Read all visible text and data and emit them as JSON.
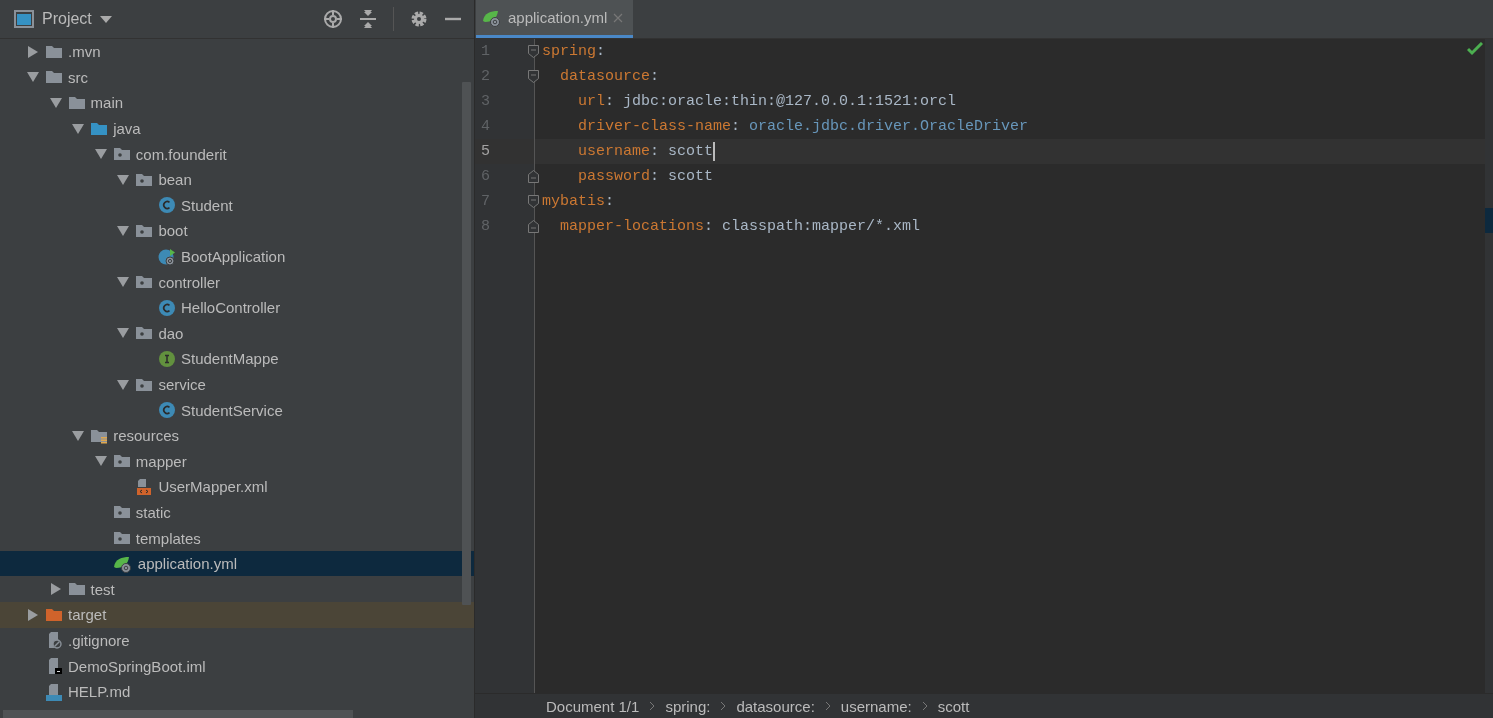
{
  "project_panel": {
    "title": "Project",
    "tree": [
      {
        "label": ".mvn",
        "kind": "folder",
        "expanded": false,
        "selected": false
      },
      {
        "label": "src",
        "kind": "folder",
        "expanded": true,
        "selected": false,
        "children": [
          {
            "label": "main",
            "kind": "folder",
            "expanded": true,
            "selected": false,
            "children": [
              {
                "label": "java",
                "kind": "source-folder",
                "expanded": true,
                "selected": false,
                "children": [
                  {
                    "label": "com.founderit",
                    "kind": "package",
                    "expanded": true,
                    "selected": false,
                    "children": [
                      {
                        "label": "bean",
                        "kind": "package",
                        "expanded": true,
                        "selected": false,
                        "children": [
                          {
                            "label": "Student",
                            "kind": "class",
                            "selected": false
                          }
                        ]
                      },
                      {
                        "label": "boot",
                        "kind": "package",
                        "expanded": true,
                        "selected": false,
                        "children": [
                          {
                            "label": "BootApplication",
                            "kind": "spring-class",
                            "selected": false
                          }
                        ]
                      },
                      {
                        "label": "controller",
                        "kind": "package",
                        "expanded": true,
                        "selected": false,
                        "children": [
                          {
                            "label": "HelloController",
                            "kind": "class",
                            "selected": false
                          }
                        ]
                      },
                      {
                        "label": "dao",
                        "kind": "package",
                        "expanded": true,
                        "selected": false,
                        "children": [
                          {
                            "label": "StudentMappe",
                            "kind": "interface",
                            "selected": false
                          }
                        ]
                      },
                      {
                        "label": "service",
                        "kind": "package",
                        "expanded": true,
                        "selected": false,
                        "children": [
                          {
                            "label": "StudentService",
                            "kind": "class",
                            "selected": false
                          }
                        ]
                      }
                    ]
                  }
                ]
              },
              {
                "label": "resources",
                "kind": "resources-folder",
                "expanded": true,
                "selected": false,
                "children": [
                  {
                    "label": "mapper",
                    "kind": "package",
                    "expanded": true,
                    "selected": false,
                    "children": [
                      {
                        "label": "UserMapper.xml",
                        "kind": "xml",
                        "selected": false
                      }
                    ]
                  },
                  {
                    "label": "static",
                    "kind": "package",
                    "selected": false
                  },
                  {
                    "label": "templates",
                    "kind": "package",
                    "selected": false
                  },
                  {
                    "label": "application.yml",
                    "kind": "spring-yml",
                    "selected": true
                  }
                ]
              }
            ]
          },
          {
            "label": "test",
            "kind": "folder",
            "expanded": false,
            "selected": false
          }
        ]
      },
      {
        "label": "target",
        "kind": "excluded-folder",
        "expanded": false,
        "selected": false
      },
      {
        "label": ".gitignore",
        "kind": "gitignore",
        "selected": false
      },
      {
        "label": "DemoSpringBoot.iml",
        "kind": "iml",
        "selected": false
      },
      {
        "label": "HELP.md",
        "kind": "md",
        "selected": false
      }
    ]
  },
  "editor": {
    "tabs": [
      {
        "label": "application.yml",
        "selected": true
      }
    ],
    "lines": [
      {
        "number": "1",
        "fold_open": true,
        "fold_close": false,
        "current": false,
        "tokens": [
          {
            "kind": "key",
            "text": "spring"
          },
          {
            "kind": "punct",
            "text": ":"
          }
        ]
      },
      {
        "number": "2",
        "fold_open": true,
        "fold_close": false,
        "current": false,
        "tokens": [
          {
            "kind": "key",
            "text": "  datasource"
          },
          {
            "kind": "punct",
            "text": ":"
          }
        ]
      },
      {
        "number": "3",
        "fold_open": false,
        "fold_close": false,
        "current": false,
        "tokens": [
          {
            "kind": "key",
            "text": "    url"
          },
          {
            "kind": "punct",
            "text": ": "
          },
          {
            "kind": "value",
            "text": "jdbc:oracle:thin:@127.0.0.1:1521:orcl"
          }
        ]
      },
      {
        "number": "4",
        "fold_open": false,
        "fold_close": false,
        "current": false,
        "tokens": [
          {
            "kind": "key",
            "text": "    driver-class-name"
          },
          {
            "kind": "punct",
            "text": ": "
          },
          {
            "kind": "reference",
            "text": "oracle.jdbc.driver.OracleDriver"
          }
        ]
      },
      {
        "number": "5",
        "fold_open": false,
        "fold_close": false,
        "current": true,
        "tokens": [
          {
            "kind": "key",
            "text": "    username"
          },
          {
            "kind": "punct",
            "text": ": "
          },
          {
            "kind": "value",
            "text": "scott"
          }
        ]
      },
      {
        "number": "6",
        "fold_open": false,
        "fold_close": true,
        "current": false,
        "tokens": [
          {
            "kind": "key",
            "text": "    password"
          },
          {
            "kind": "punct",
            "text": ": "
          },
          {
            "kind": "value",
            "text": "scott"
          }
        ]
      },
      {
        "number": "7",
        "fold_open": true,
        "fold_close": false,
        "current": false,
        "tokens": [
          {
            "kind": "key",
            "text": "mybatis"
          },
          {
            "kind": "punct",
            "text": ":"
          }
        ]
      },
      {
        "number": "8",
        "fold_open": false,
        "fold_close": true,
        "current": false,
        "tokens": [
          {
            "kind": "key",
            "text": "  mapper-locations"
          },
          {
            "kind": "punct",
            "text": ": "
          },
          {
            "kind": "value",
            "text": "classpath:mapper/*.xml"
          }
        ]
      }
    ],
    "breadcrumbs": [
      "Document 1/1",
      "spring:",
      "datasource:",
      "username:",
      "scott"
    ]
  }
}
